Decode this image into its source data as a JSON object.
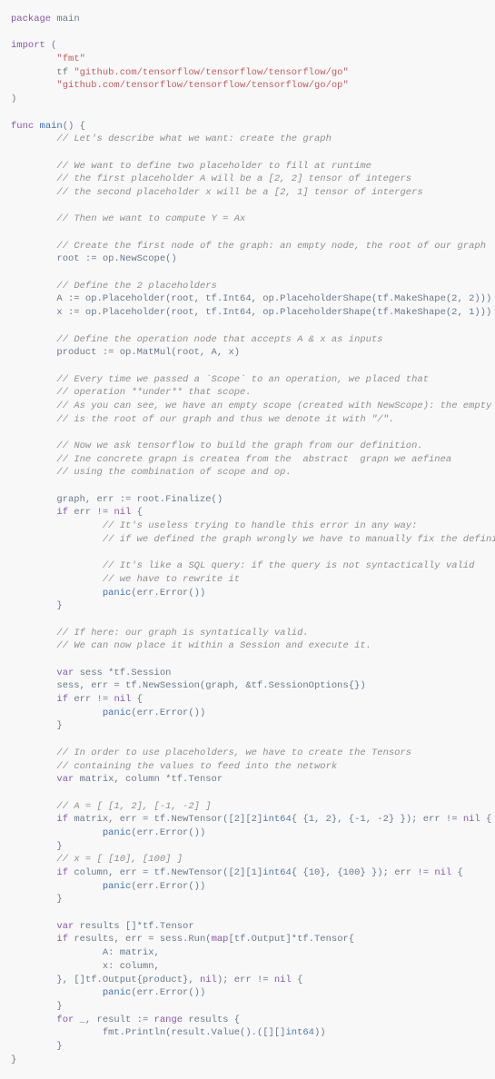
{
  "code": [
    {
      "t": "kw",
      "v": "package"
    },
    {
      "t": "",
      "v": " main\n\n"
    },
    {
      "t": "kw",
      "v": "import"
    },
    {
      "t": "",
      "v": " (\n        "
    },
    {
      "t": "str",
      "v": "\"fmt\""
    },
    {
      "t": "",
      "v": "\n        tf "
    },
    {
      "t": "str",
      "v": "\"github.com/tensorflow/tensorflow/tensorflow/go\""
    },
    {
      "t": "",
      "v": "\n        "
    },
    {
      "t": "str",
      "v": "\"github.com/tensorflow/tensorflow/tensorflow/go/op\""
    },
    {
      "t": "",
      "v": "\n)\n\n"
    },
    {
      "t": "kw",
      "v": "func"
    },
    {
      "t": "",
      "v": " "
    },
    {
      "t": "func",
      "v": "main"
    },
    {
      "t": "",
      "v": "() {\n        "
    },
    {
      "t": "cmt",
      "v": "// Let's describe what we want: create the graph"
    },
    {
      "t": "",
      "v": "\n\n        "
    },
    {
      "t": "cmt",
      "v": "// We want to define two placeholder to fill at runtime"
    },
    {
      "t": "",
      "v": "\n        "
    },
    {
      "t": "cmt",
      "v": "// the first placeholder A will be a [2, 2] tensor of integers"
    },
    {
      "t": "",
      "v": "\n        "
    },
    {
      "t": "cmt",
      "v": "// the second placeholder x will be a [2, 1] tensor of intergers"
    },
    {
      "t": "",
      "v": "\n\n        "
    },
    {
      "t": "cmt",
      "v": "// Then we want to compute Y = Ax"
    },
    {
      "t": "",
      "v": "\n\n        "
    },
    {
      "t": "cmt",
      "v": "// Create the first node of the graph: an empty node, the root of our graph"
    },
    {
      "t": "",
      "v": "\n        root := op.NewScope()\n\n        "
    },
    {
      "t": "cmt",
      "v": "// Define the 2 placeholders"
    },
    {
      "t": "",
      "v": "\n        A := op.Placeholder(root, tf.Int64, op.PlaceholderShape(tf.MakeShape(2, 2)))\n        x := op.Placeholder(root, tf.Int64, op.PlaceholderShape(tf.MakeShape(2, 1)))\n\n        "
    },
    {
      "t": "cmt",
      "v": "// Define the operation node that accepts A & x as inputs"
    },
    {
      "t": "",
      "v": "\n        product := op.MatMul(root, A, x)\n\n        "
    },
    {
      "t": "cmt",
      "v": "// Every time we passed a `Scope` to an operation, we placed that"
    },
    {
      "t": "",
      "v": "\n        "
    },
    {
      "t": "cmt",
      "v": "// operation **under** that scope."
    },
    {
      "t": "",
      "v": "\n        "
    },
    {
      "t": "cmt",
      "v": "// As you can see, we have an empty scope (created with NewScope): the empty scope"
    },
    {
      "t": "",
      "v": "\n        "
    },
    {
      "t": "cmt",
      "v": "// is the root of our graph and thus we denote it with \"/\"."
    },
    {
      "t": "",
      "v": "\n\n        "
    },
    {
      "t": "cmt",
      "v": "// Now we ask tensorflow to build the graph from our definition."
    },
    {
      "t": "",
      "v": "\n        "
    },
    {
      "t": "cmt",
      "v": "// Ine concrete grapn is createa from the  abstract  grapn we aefinea"
    },
    {
      "t": "",
      "v": "\n        "
    },
    {
      "t": "cmt",
      "v": "// using the combination of scope and op."
    },
    {
      "t": "",
      "v": "\n\n        graph, err := root.Finalize()\n        "
    },
    {
      "t": "kw",
      "v": "if"
    },
    {
      "t": "",
      "v": " err != "
    },
    {
      "t": "kw",
      "v": "nil"
    },
    {
      "t": "",
      "v": " {\n                "
    },
    {
      "t": "cmt",
      "v": "// It's useless trying to handle this error in any way:"
    },
    {
      "t": "",
      "v": "\n                "
    },
    {
      "t": "cmt",
      "v": "// if we defined the graph wrongly we have to manually fix the definition."
    },
    {
      "t": "",
      "v": "\n\n                "
    },
    {
      "t": "cmt",
      "v": "// It's like a SQL query: if the query is not syntactically valid"
    },
    {
      "t": "",
      "v": "\n                "
    },
    {
      "t": "cmt",
      "v": "// we have to rewrite it"
    },
    {
      "t": "",
      "v": "\n                "
    },
    {
      "t": "func",
      "v": "panic"
    },
    {
      "t": "",
      "v": "(err.Error())\n        }\n\n        "
    },
    {
      "t": "cmt",
      "v": "// If here: our graph is syntatically valid."
    },
    {
      "t": "",
      "v": "\n        "
    },
    {
      "t": "cmt",
      "v": "// We can now place it within a Session and execute it."
    },
    {
      "t": "",
      "v": "\n\n        "
    },
    {
      "t": "kw",
      "v": "var"
    },
    {
      "t": "",
      "v": " sess *tf.Session\n        sess, err = tf.NewSession(graph, &tf.SessionOptions{})\n        "
    },
    {
      "t": "kw",
      "v": "if"
    },
    {
      "t": "",
      "v": " err != "
    },
    {
      "t": "kw",
      "v": "nil"
    },
    {
      "t": "",
      "v": " {\n                "
    },
    {
      "t": "func",
      "v": "panic"
    },
    {
      "t": "",
      "v": "(err.Error())\n        }\n\n        "
    },
    {
      "t": "cmt",
      "v": "// In order to use placeholders, we have to create the Tensors"
    },
    {
      "t": "",
      "v": "\n        "
    },
    {
      "t": "cmt",
      "v": "// containing the values to feed into the network"
    },
    {
      "t": "",
      "v": "\n        "
    },
    {
      "t": "kw",
      "v": "var"
    },
    {
      "t": "",
      "v": " matrix, column *tf.Tensor\n\n        "
    },
    {
      "t": "cmt",
      "v": "// A = [ [1, 2], [-1, -2] ]"
    },
    {
      "t": "",
      "v": "\n        "
    },
    {
      "t": "kw",
      "v": "if"
    },
    {
      "t": "",
      "v": " matrix, err = tf.NewTensor([2][2]"
    },
    {
      "t": "type",
      "v": "int64"
    },
    {
      "t": "",
      "v": "{ {1, 2}, {-1, -2} }); err != "
    },
    {
      "t": "kw",
      "v": "nil"
    },
    {
      "t": "",
      "v": " {\n                "
    },
    {
      "t": "func",
      "v": "panic"
    },
    {
      "t": "",
      "v": "(err.Error())\n        }\n        "
    },
    {
      "t": "cmt",
      "v": "// x = [ [10], [100] ]"
    },
    {
      "t": "",
      "v": "\n        "
    },
    {
      "t": "kw",
      "v": "if"
    },
    {
      "t": "",
      "v": " column, err = tf.NewTensor([2][1]"
    },
    {
      "t": "type",
      "v": "int64"
    },
    {
      "t": "",
      "v": "{ {10}, {100} }); err != "
    },
    {
      "t": "kw",
      "v": "nil"
    },
    {
      "t": "",
      "v": " {\n                "
    },
    {
      "t": "func",
      "v": "panic"
    },
    {
      "t": "",
      "v": "(err.Error())\n        }\n\n        "
    },
    {
      "t": "kw",
      "v": "var"
    },
    {
      "t": "",
      "v": " results []*tf.Tensor\n        "
    },
    {
      "t": "kw",
      "v": "if"
    },
    {
      "t": "",
      "v": " results, err = sess.Run("
    },
    {
      "t": "kw",
      "v": "map"
    },
    {
      "t": "",
      "v": "[tf.Output]*tf.Tensor{\n                A: matrix,\n                x: column,\n        }, []tf.Output{product}, "
    },
    {
      "t": "kw",
      "v": "nil"
    },
    {
      "t": "",
      "v": "); err != "
    },
    {
      "t": "kw",
      "v": "nil"
    },
    {
      "t": "",
      "v": " {\n                "
    },
    {
      "t": "func",
      "v": "panic"
    },
    {
      "t": "",
      "v": "(err.Error())\n        }\n        "
    },
    {
      "t": "kw",
      "v": "for"
    },
    {
      "t": "",
      "v": " _, result := "
    },
    {
      "t": "kw",
      "v": "range"
    },
    {
      "t": "",
      "v": " results {\n                fmt.Println(result.Value().([][]"
    },
    {
      "t": "type",
      "v": "int64"
    },
    {
      "t": "",
      "v": "))\n        }\n}\n"
    }
  ]
}
